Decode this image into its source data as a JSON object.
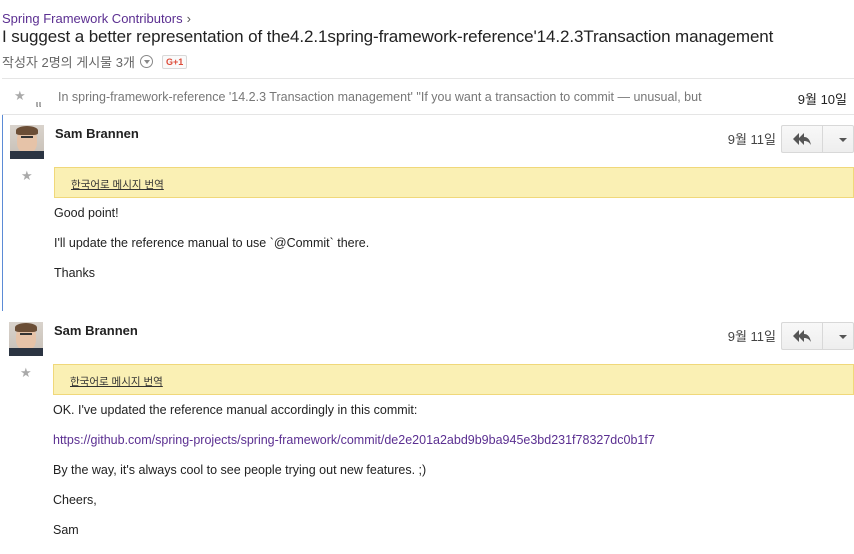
{
  "header": {
    "breadcrumb": "Spring Framework Contributors",
    "breadcrumb_sep": "›",
    "title": "I suggest a better representation of the4.2.1spring-framework-reference'14.2.3Transaction management",
    "meta": "작성자 2명의 게시물 3개",
    "gplus_label": "G+1"
  },
  "collapsed": {
    "avatar_stub": "ιι",
    "snippet": "In spring-framework-reference '14.2.3 Transaction management' \"If you want a transaction to commit — unusual, but",
    "date": "9월 10일"
  },
  "messages": [
    {
      "sender": "Sam Brannen",
      "date": "9월 11일",
      "translate": "한국어로 메시지 번역",
      "lines": [
        "Good point!",
        "I'll update the reference manual to use `@Commit` there.",
        "Thanks"
      ]
    },
    {
      "sender": "Sam Brannen",
      "date": "9월 11일",
      "translate": "한국어로 메시지 번역",
      "lines": [
        "OK. I've updated the reference manual accordingly in this commit:",
        "https://github.com/spring-projects/spring-framework/commit/de2e201a2abd9b9ba945e3bd231f78327dc0b1f7",
        "By the way, it's always cool to see people trying out new features. ;)",
        "Cheers,",
        "Sam"
      ]
    }
  ],
  "colors": {
    "link": "#5b2f91",
    "translate_bg": "#faf0b4",
    "focus_border": "#5b8bd6"
  }
}
